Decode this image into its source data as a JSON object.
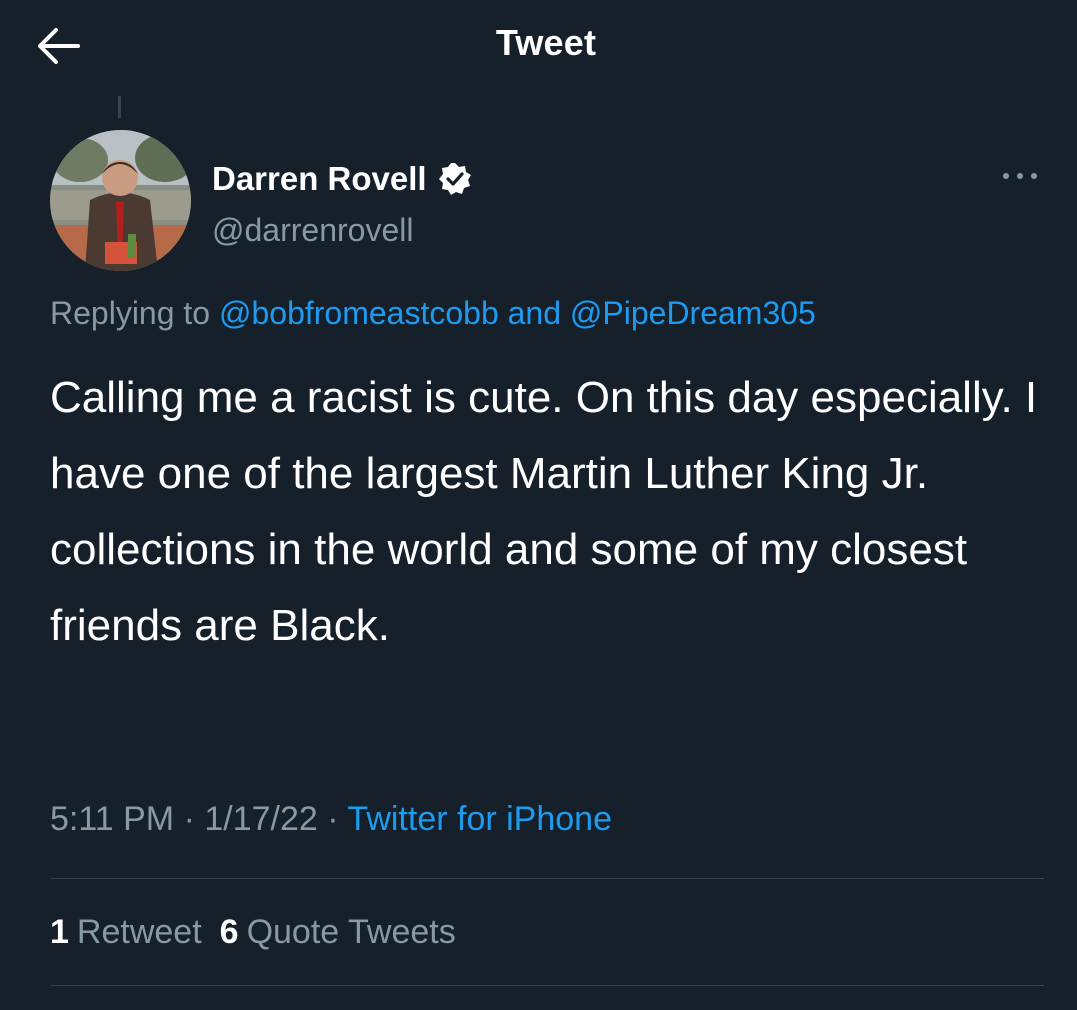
{
  "header": {
    "title": "Tweet",
    "back_icon": "arrow-left-icon"
  },
  "tweet": {
    "author": {
      "display_name": "Darren Rovell",
      "handle": "@darrenrovell",
      "verified": true,
      "verified_icon": "verified-badge-icon"
    },
    "more_icon": "more-horizontal-icon",
    "replying": {
      "prefix": "Replying to",
      "mention_1": "@bobfromeastcobb",
      "joiner": "and",
      "mention_2": "@PipeDream305"
    },
    "text": "Calling me a racist is cute. On this day especially. I have one of the largest Martin Luther King Jr. collections in the world and some of my closest friends are Black.",
    "meta": {
      "time": "5:11 PM",
      "separator": "·",
      "date": "1/17/22",
      "source": "Twitter for iPhone"
    },
    "stats": {
      "retweets_count": "1",
      "retweets_label": "Retweet",
      "quotes_count": "6",
      "quotes_label": "Quote Tweets"
    }
  },
  "colors": {
    "background": "#15202b",
    "text_primary": "#ffffff",
    "text_secondary": "#8899a6",
    "accent": "#1d9bf0",
    "divider": "#38444d"
  }
}
